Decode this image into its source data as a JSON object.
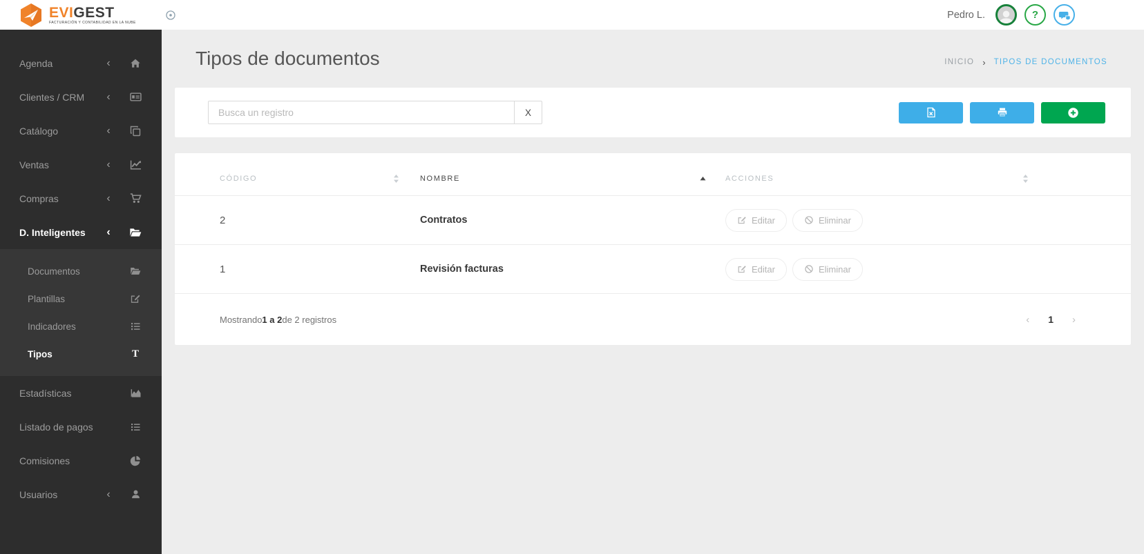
{
  "topbar": {
    "brand": {
      "name_part1": "EVI",
      "name_part2": "GEST",
      "tagline": "FACTURACIÓN Y CONTABILIDAD EN LA NUBE",
      "logo_icon": "paper-plane-hexagon-icon"
    },
    "toggle_icon": "circle-dot-icon",
    "user_name": "Pedro L.",
    "help_glyph": "?",
    "icons": {
      "avatar": "user-avatar-icon",
      "help": "question-icon",
      "chat": "chat-bubbles-icon"
    }
  },
  "sidebar": {
    "chevron_glyph": "‹",
    "items": [
      {
        "label": "Agenda",
        "icon": "home-icon"
      },
      {
        "label": "Clientes / CRM",
        "icon": "id-card-icon"
      },
      {
        "label": "Catálogo",
        "icon": "clone-icon"
      },
      {
        "label": "Ventas",
        "icon": "line-chart-icon"
      },
      {
        "label": "Compras",
        "icon": "shopping-cart-icon"
      },
      {
        "label": "D. Inteligentes",
        "icon": "folder-open-icon",
        "active": true
      }
    ],
    "submenu": [
      {
        "label": "Documentos",
        "icon": "folder-open-icon"
      },
      {
        "label": "Plantillas",
        "icon": "edit-icon"
      },
      {
        "label": "Indicadores",
        "icon": "list-icon"
      },
      {
        "label": "Tipos",
        "icon": "letter-t-icon",
        "icon_glyph": "T",
        "active": true
      }
    ],
    "bottom_items": [
      {
        "label": "Estadísticas",
        "icon": "area-chart-icon"
      },
      {
        "label": "Listado de pagos",
        "icon": "list-icon"
      },
      {
        "label": "Comisiones",
        "icon": "pie-chart-icon"
      },
      {
        "label": "Usuarios",
        "icon": "user-icon",
        "chevron": true
      }
    ]
  },
  "page": {
    "title": "Tipos de documentos",
    "breadcrumb": {
      "home": "INICIO",
      "separator": "›",
      "current": "TIPOS DE DOCUMENTOS"
    }
  },
  "toolbar": {
    "search_placeholder": "Busca un registro",
    "clear_button": "X",
    "buttons": [
      {
        "name": "export-excel",
        "icon": "excel-file-icon",
        "color": "#3eaee8"
      },
      {
        "name": "print",
        "icon": "printer-icon",
        "color": "#3eaee8"
      },
      {
        "name": "add-record",
        "icon": "plus-circle-icon",
        "color": "#00a650"
      }
    ]
  },
  "table": {
    "columns": [
      {
        "label": "CÓDIGO",
        "sort": "both"
      },
      {
        "label": "NOMBRE",
        "sort": "asc"
      },
      {
        "label": "ACCIONES",
        "sort": "both"
      }
    ],
    "actions": {
      "edit": "Editar",
      "delete": "Eliminar"
    },
    "rows": [
      {
        "codigo": "2",
        "nombre": "Contratos"
      },
      {
        "codigo": "1",
        "nombre": "Revisión facturas"
      }
    ],
    "footer": {
      "showing_prefix": "Mostrando",
      "showing_range": "1 a 2",
      "showing_suffix": "de 2 registros",
      "pagination": {
        "prev": "‹",
        "current": "1",
        "next": "›"
      }
    }
  },
  "colors": {
    "sidebar_bg": "#2d2d2d",
    "submenu_bg": "#373737",
    "accent_blue": "#3eaee8",
    "accent_green": "#00a650",
    "breadcrumb_active": "#4fb3e8",
    "logo_orange": "#f0832a"
  }
}
